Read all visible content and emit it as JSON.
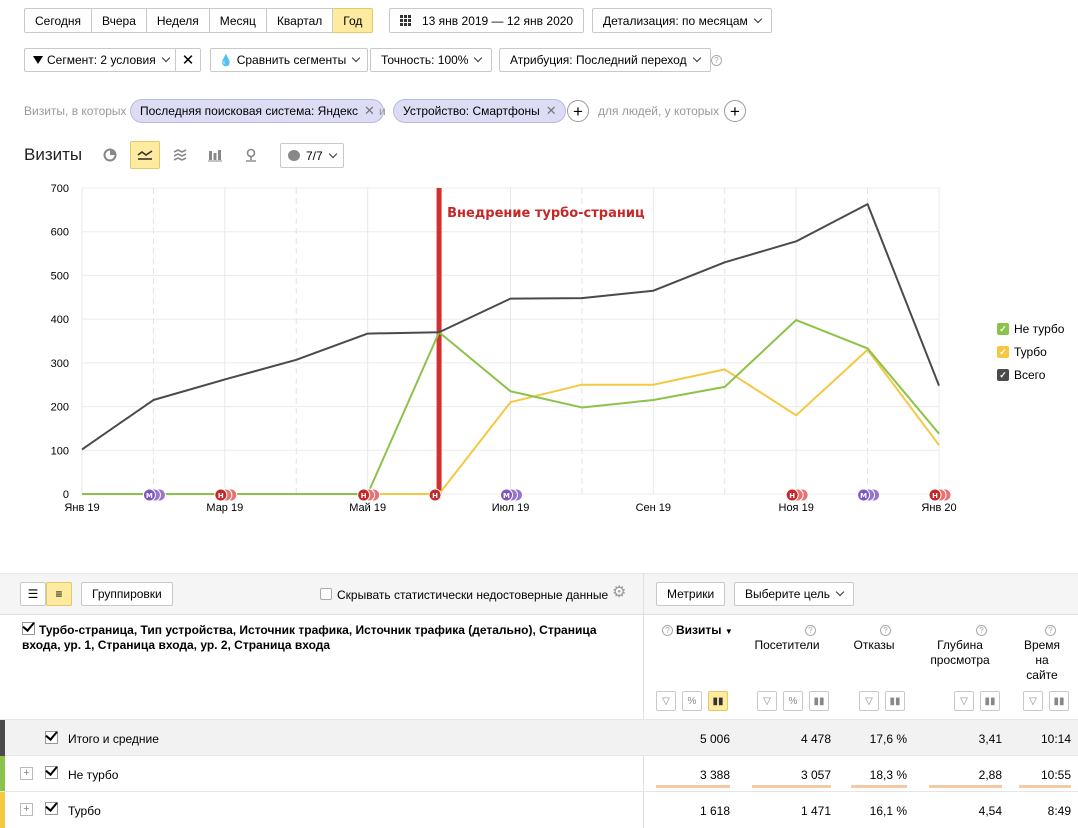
{
  "period": {
    "buttons": [
      "Сегодня",
      "Вчера",
      "Неделя",
      "Месяц",
      "Квартал",
      "Год"
    ],
    "active": "Год",
    "date_range": "13 янв 2019 — 12 янв 2020",
    "detail": "Детализация: по месяцам"
  },
  "filters": {
    "segment": "Сегмент: 2 условия",
    "compare": "Сравнить сегменты",
    "accuracy": "Точность: 100%",
    "attribution": "Атрибуция: Последний переход"
  },
  "conditions": {
    "prefix": "Визиты, в которых",
    "chip1": "Последняя поисковая система: Яндекс",
    "and": "и",
    "chip2": "Устройство: Смартфоны",
    "people": "для людей, у которых"
  },
  "chart_header": {
    "title": "Визиты",
    "annotations_count": "7/7"
  },
  "colors": {
    "not_turbo": "#8bc34a",
    "turbo": "#f5c842",
    "total": "#4a4a4a",
    "marker": "#d32f2f",
    "accent": "#ffeba0"
  },
  "chart_data": {
    "type": "line",
    "x": [
      "2019-01",
      "2019-02",
      "2019-03",
      "2019-04",
      "2019-05",
      "2019-06",
      "2019-07",
      "2019-08",
      "2019-09",
      "2019-10",
      "2019-11",
      "2019-12",
      "2020-01"
    ],
    "x_tick_labels": [
      "Янв 19",
      "Мар 19",
      "Май 19",
      "Июл 19",
      "Сен 19",
      "Ноя 19",
      "Янв 20"
    ],
    "ylim": [
      0,
      700
    ],
    "y_ticks": [
      "0",
      "100",
      "200",
      "300",
      "400",
      "500",
      "600",
      "700"
    ],
    "series": [
      {
        "name": "Не турбо",
        "values": [
          0,
          0,
          0,
          0,
          0,
          370,
          235,
          198,
          215,
          245,
          398,
          333,
          138
        ]
      },
      {
        "name": "Турбо",
        "values": [
          0,
          0,
          0,
          0,
          0,
          0,
          210,
          250,
          250,
          285,
          180,
          330,
          112
        ]
      },
      {
        "name": "Всего",
        "values": [
          102,
          215,
          262,
          307,
          367,
          370,
          447,
          448,
          465,
          530,
          578,
          663,
          248
        ]
      }
    ],
    "annotation": {
      "x": "2019-06",
      "label": "Внедрение турбо-страниц"
    },
    "grid": true,
    "legend_position": "right",
    "markers": [
      {
        "x": "2019-02",
        "type": "М"
      },
      {
        "x": "2019-03",
        "type": "Н"
      },
      {
        "x": "2019-05",
        "type": "Н"
      },
      {
        "x": "2019-06",
        "type": "Н"
      },
      {
        "x": "2019-07",
        "type": "М"
      },
      {
        "x": "2019-11",
        "type": "Н"
      },
      {
        "x": "2019-12",
        "type": "М"
      },
      {
        "x": "2020-01",
        "type": "Н"
      }
    ]
  },
  "table": {
    "view_groupings": "Группировки",
    "hide_label": "Скрывать статистически недостоверные данные",
    "metrics_btn": "Метрики",
    "goal_btn": "Выберите цель",
    "dimensions": "Турбо-страница, Тип устройства, Источник трафика, Источник трафика (детально), Страница входа, ур. 1, Страница входа, ур. 2, Страница входа",
    "columns": [
      "Визиты",
      "Посетители",
      "Отказы",
      "Глубина просмотра",
      "Время на сайте"
    ],
    "rows": [
      {
        "label": "Итого и средние",
        "values": [
          "5 006",
          "4 478",
          "17,6 %",
          "3,41",
          "10:14"
        ]
      },
      {
        "label": "Не турбо",
        "values": [
          "3 388",
          "3 057",
          "18,3 %",
          "2,88",
          "10:55"
        ]
      },
      {
        "label": "Турбо",
        "values": [
          "1 618",
          "1 471",
          "16,1 %",
          "4,54",
          "8:49"
        ]
      }
    ]
  }
}
